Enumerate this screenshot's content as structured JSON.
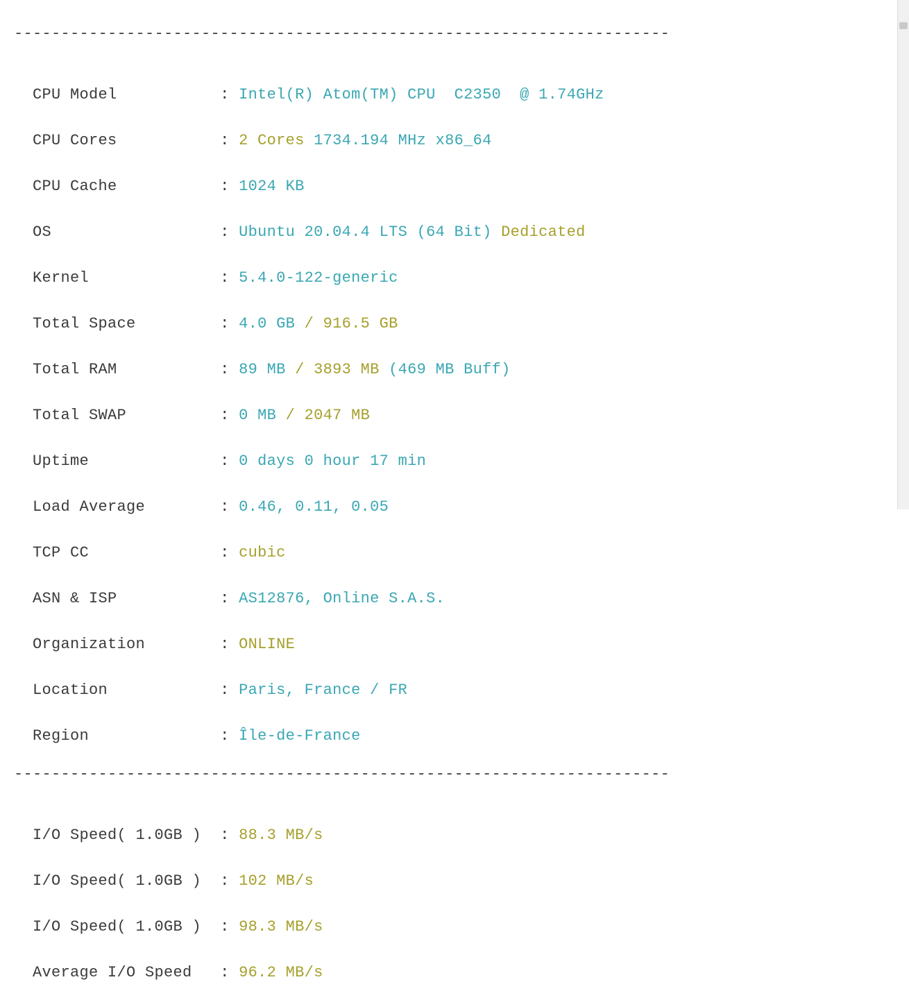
{
  "divider": "----------------------------------------------------------------------",
  "labels": {
    "cpu_model": "CPU Model          ",
    "cpu_cores": "CPU Cores          ",
    "cpu_cache": "CPU Cache          ",
    "os": "OS                 ",
    "kernel": "Kernel             ",
    "total_space": "Total Space        ",
    "total_ram": "Total RAM          ",
    "total_swap": "Total SWAP         ",
    "uptime": "Uptime             ",
    "load_avg": "Load Average       ",
    "tcp_cc": "TCP CC             ",
    "asn_isp": "ASN & ISP          ",
    "org": "Organization       ",
    "location": "Location           ",
    "region": "Region             ",
    "io1": "I/O Speed( 1.0GB ) ",
    "io2": "I/O Speed( 1.0GB ) ",
    "io3": "I/O Speed( 1.0GB ) ",
    "io_avg": "Average I/O Speed  "
  },
  "sep": " : ",
  "values": {
    "cpu_model": "Intel(R) Atom(TM) CPU  C2350  @ 1.74GHz",
    "cores_a": "2 Cores ",
    "cores_b": "1734.194 MHz x86_64",
    "cpu_cache": "1024 KB",
    "os_a": "Ubuntu 20.04.4 LTS (64 Bit) ",
    "os_b": "Dedicated",
    "kernel": "5.4.0-122-generic",
    "space_a": "4.0 GB ",
    "space_b": "/ 916.5 GB",
    "ram_a": "89 MB ",
    "ram_b": "/ 3893 MB ",
    "ram_c": "(469 MB Buff)",
    "swap_a": "0 MB ",
    "swap_b": "/ 2047 MB",
    "uptime": "0 days 0 hour 17 min",
    "load_avg": "0.46, 0.11, 0.05",
    "tcp_cc": "cubic",
    "asn_isp": "AS12876, Online S.A.S.",
    "org": "ONLINE",
    "location": "Paris, France / FR",
    "region": "Île-de-France",
    "io1": "88.3 MB/s",
    "io2": "102 MB/s",
    "io3": "98.3 MB/s",
    "io_avg": "96.2 MB/s"
  }
}
